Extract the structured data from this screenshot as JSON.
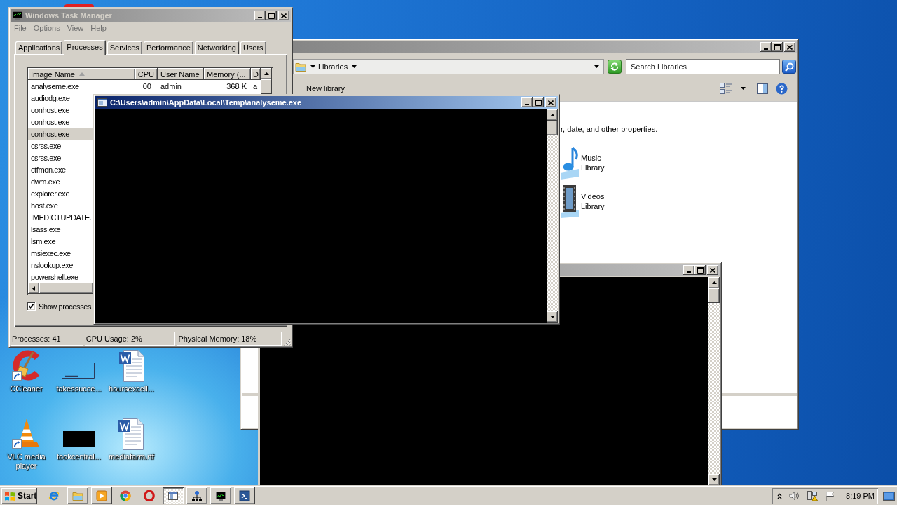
{
  "desktop": {
    "icons": [
      {
        "label": "CCleaner",
        "kind": "cleaner"
      },
      {
        "label": "takessucce...",
        "kind": "thumbnail"
      },
      {
        "label": "hoursexcell...",
        "kind": "document"
      },
      {
        "label": "VLC media player",
        "kind": "cone"
      },
      {
        "label": "tookcentral...",
        "kind": "darkimage"
      },
      {
        "label": "mediafarm.rtf",
        "kind": "document"
      }
    ]
  },
  "explorer_window": {
    "active": false,
    "address": "Libraries",
    "search": {
      "placeholder": "Search Libraries"
    },
    "toolbar": [
      "New library"
    ],
    "description": "r, date, and other properties.",
    "libraries": [
      {
        "label": "Music Library",
        "kind": "music"
      },
      {
        "label": "Videos Library",
        "kind": "videos"
      }
    ]
  },
  "background_console_window": {
    "active": false
  },
  "task_manager": {
    "active": false,
    "title": "Windows Task Manager",
    "menu": [
      "File",
      "Options",
      "View",
      "Help"
    ],
    "tabs": [
      {
        "label": "Applications",
        "selected": false
      },
      {
        "label": "Processes",
        "selected": true
      },
      {
        "label": "Services",
        "selected": false
      },
      {
        "label": "Performance",
        "selected": false
      },
      {
        "label": "Networking",
        "selected": false
      },
      {
        "label": "Users",
        "selected": false
      }
    ],
    "columns": [
      {
        "label": "Image Name",
        "sorted": true
      },
      {
        "label": "CPU"
      },
      {
        "label": "User Name"
      },
      {
        "label": "Memory (..."
      },
      {
        "label": "D"
      }
    ],
    "rows": [
      {
        "cells": [
          "analyseme.exe",
          "00",
          "admin",
          "368 K",
          "a"
        ],
        "selected": false
      },
      {
        "cells": [
          "audiodg.exe"
        ],
        "selected": false
      },
      {
        "cells": [
          "conhost.exe"
        ],
        "selected": false
      },
      {
        "cells": [
          "conhost.exe"
        ],
        "selected": false
      },
      {
        "cells": [
          "conhost.exe"
        ],
        "selected": true
      },
      {
        "cells": [
          "csrss.exe"
        ],
        "selected": false
      },
      {
        "cells": [
          "csrss.exe"
        ],
        "selected": false
      },
      {
        "cells": [
          "ctfmon.exe"
        ],
        "selected": false
      },
      {
        "cells": [
          "dwm.exe"
        ],
        "selected": false
      },
      {
        "cells": [
          "explorer.exe"
        ],
        "selected": false
      },
      {
        "cells": [
          "host.exe"
        ],
        "selected": false
      },
      {
        "cells": [
          "IMEDICTUPDATE."
        ],
        "selected": false
      },
      {
        "cells": [
          "lsass.exe"
        ],
        "selected": false
      },
      {
        "cells": [
          "lsm.exe"
        ],
        "selected": false
      },
      {
        "cells": [
          "msiexec.exe"
        ],
        "selected": false
      },
      {
        "cells": [
          "nslookup.exe"
        ],
        "selected": false
      },
      {
        "cells": [
          "powershell.exe"
        ],
        "selected": false
      }
    ],
    "show_processes": {
      "label": "Show processes",
      "checked": true
    },
    "status_bar": [
      "Processes: 41",
      "CPU Usage: 2%",
      "Physical Memory: 18%"
    ]
  },
  "console_window": {
    "active": true,
    "title": "C:\\Users\\admin\\AppData\\Local\\Temp\\analyseme.exe"
  },
  "taskbar": {
    "start": "Start",
    "items": [
      {
        "kind": "ie",
        "running": false,
        "selected": false
      },
      {
        "kind": "folder",
        "running": true,
        "selected": false
      },
      {
        "kind": "player",
        "running": true,
        "selected": false
      },
      {
        "kind": "chrome",
        "running": false,
        "selected": false
      },
      {
        "kind": "opera",
        "running": false,
        "selected": false
      },
      {
        "kind": "console",
        "running": true,
        "selected": true
      },
      {
        "kind": "network",
        "running": true,
        "selected": false
      },
      {
        "kind": "monitor",
        "running": true,
        "selected": false
      },
      {
        "kind": "shell",
        "running": true,
        "selected": false
      }
    ],
    "tray": {
      "icons": [
        {
          "kind": "chevron"
        },
        {
          "kind": "speaker"
        },
        {
          "kind": "network"
        },
        {
          "kind": "flag"
        }
      ],
      "time": "8:19 PM"
    }
  }
}
